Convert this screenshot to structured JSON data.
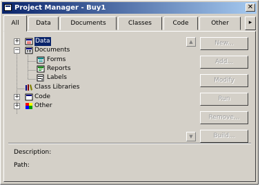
{
  "window": {
    "title": "Project Manager - Buy1",
    "close_glyph": "✕"
  },
  "tabs": [
    {
      "label": "All",
      "active": true
    },
    {
      "label": "Data",
      "active": false
    },
    {
      "label": "Documents",
      "active": false
    },
    {
      "label": "Classes",
      "active": false
    },
    {
      "label": "Code",
      "active": false
    },
    {
      "label": "Other",
      "active": false
    }
  ],
  "tab_scroll_glyph": "▸",
  "tree": {
    "items": [
      {
        "label": "Data",
        "expander": "+",
        "icon": "data-icon",
        "selected": true
      },
      {
        "label": "Documents",
        "expander": "−",
        "icon": "documents-icon"
      },
      {
        "label": "Forms",
        "icon": "forms-icon"
      },
      {
        "label": "Reports",
        "icon": "reports-icon"
      },
      {
        "label": "Labels",
        "icon": "labels-icon"
      },
      {
        "label": "Class Libraries",
        "icon": "class-libraries-icon"
      },
      {
        "label": "Code",
        "expander": "+",
        "icon": "code-icon"
      },
      {
        "label": "Other",
        "expander": "+",
        "icon": "other-icon"
      }
    ]
  },
  "scroll": {
    "up_glyph": "▲",
    "down_glyph": "▼"
  },
  "actions": {
    "new": "New...",
    "add": "Add...",
    "modify": "Modify",
    "run": "Run",
    "remove": "Remove...",
    "build": "Build..."
  },
  "info": {
    "description_label": "Description:",
    "path_label": "Path:"
  },
  "colors": {
    "title_start": "#0a246a",
    "title_end": "#a6caf0",
    "face": "#d4d0c8",
    "selection": "#0a246a"
  }
}
